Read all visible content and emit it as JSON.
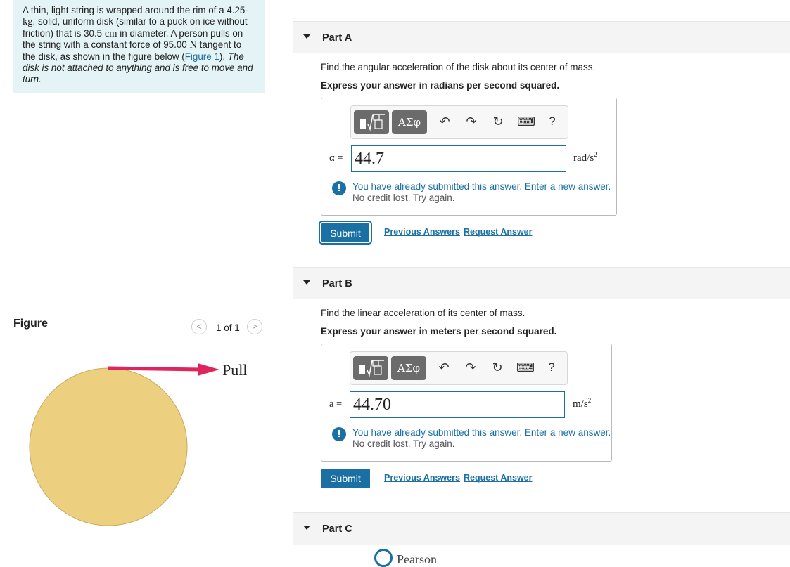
{
  "problem": {
    "text_1": "A thin, light string is wrapped around the rim of a ",
    "mass_value": "4.25-",
    "mass_unit": "kg",
    "text_2": ", solid, uniform disk (similar to a puck on ice without friction) that is 30.5 ",
    "diameter_unit": "cm",
    "text_3": " in diameter. A person pulls on the string with a constant force of 95.00 ",
    "force_unit": "N",
    "text_4": " tangent to the disk, as shown in the figure below (",
    "figure_link": "Figure 1",
    "text_5": "). ",
    "note": "The disk is not attached to anything and is free to move and turn."
  },
  "figure": {
    "title": "Figure",
    "counter": "1 of 1",
    "pull_label": "Pull",
    "disk_color": "#ecd07f",
    "arrow_color": "#e0245e"
  },
  "parts": [
    {
      "title": "Part A",
      "question": "Find the angular acceleration of the disk about its center of mass.",
      "instruction": "Express your answer in radians per second squared.",
      "variable": "α =",
      "value": "44.7",
      "unit_base": "rad/s",
      "unit_exp": "2",
      "feedback_1": "You have already submitted this answer. Enter a new answer.",
      "feedback_2": "No credit lost. Try again.",
      "submit": "Submit",
      "prev_answers": "Previous Answers",
      "request_answer": "Request Answer"
    },
    {
      "title": "Part B",
      "question": "Find the linear acceleration of its center of mass.",
      "instruction": "Express your answer in meters per second squared.",
      "variable": "a =",
      "value": "44.70",
      "unit_base": "m/s",
      "unit_exp": "2",
      "feedback_1": "You have already submitted this answer. Enter a new answer.",
      "feedback_2": "No credit lost. Try again.",
      "submit": "Submit",
      "prev_answers": "Previous Answers",
      "request_answer": "Request Answer"
    },
    {
      "title": "Part C"
    }
  ],
  "toolbar": {
    "greek_label": "ΑΣφ",
    "undo_icon": "↶",
    "redo_icon": "↷",
    "reset_icon": "↻",
    "keyboard_icon": "⌨",
    "help_label": "?"
  },
  "footer": {
    "brand": "Pearson"
  },
  "colors": {
    "accent": "#1a6fa3",
    "problem_bg": "#e4f3f5",
    "part_bg": "#f4f4f4"
  }
}
